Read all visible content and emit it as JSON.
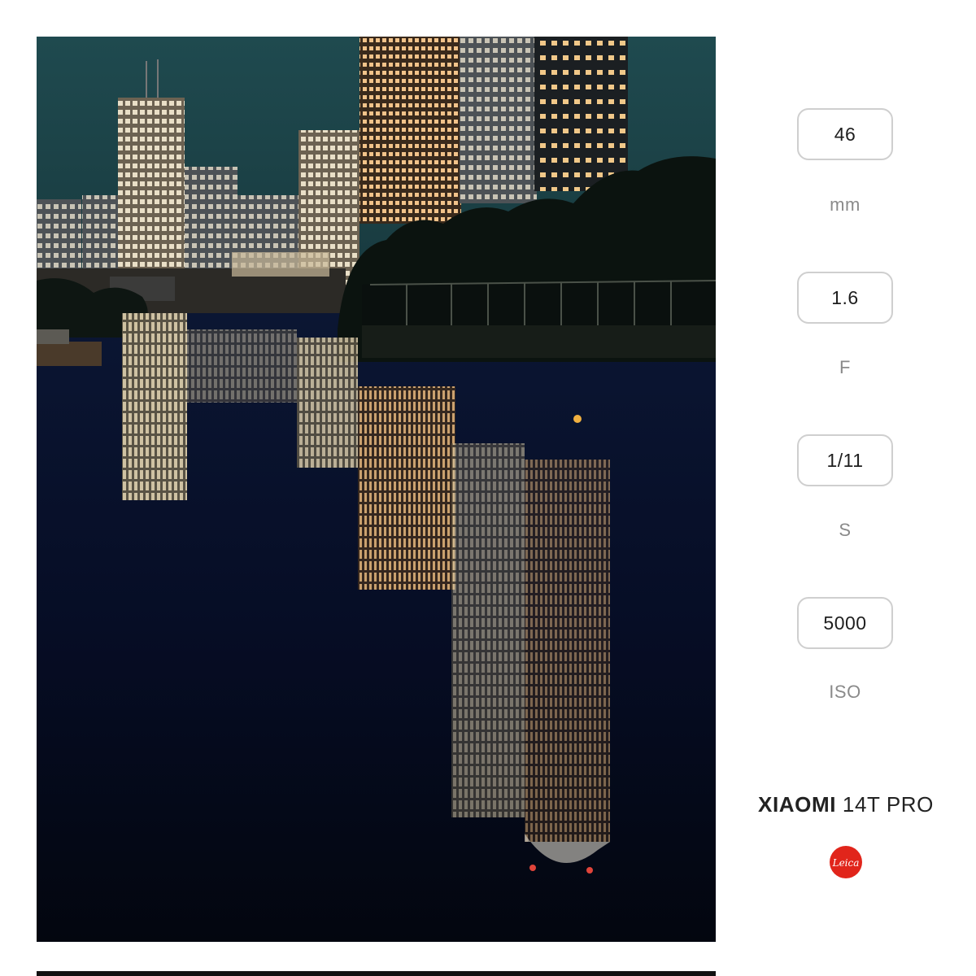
{
  "exif": [
    {
      "value": "46",
      "unit": "mm"
    },
    {
      "value": "1.6",
      "unit": "F"
    },
    {
      "value": "1/11",
      "unit": "S"
    },
    {
      "value": "5000",
      "unit": "ISO"
    }
  ],
  "camera": {
    "brand": "XIAOMI",
    "model": "14T PRO"
  },
  "logo": {
    "text": "Leica",
    "color": "#e1251b"
  },
  "colors": {
    "sky": "#16393f",
    "water": "#050a1c",
    "accent": "#e1251b"
  },
  "photo": {
    "subject_icon": "night-city-reflection-photo"
  }
}
